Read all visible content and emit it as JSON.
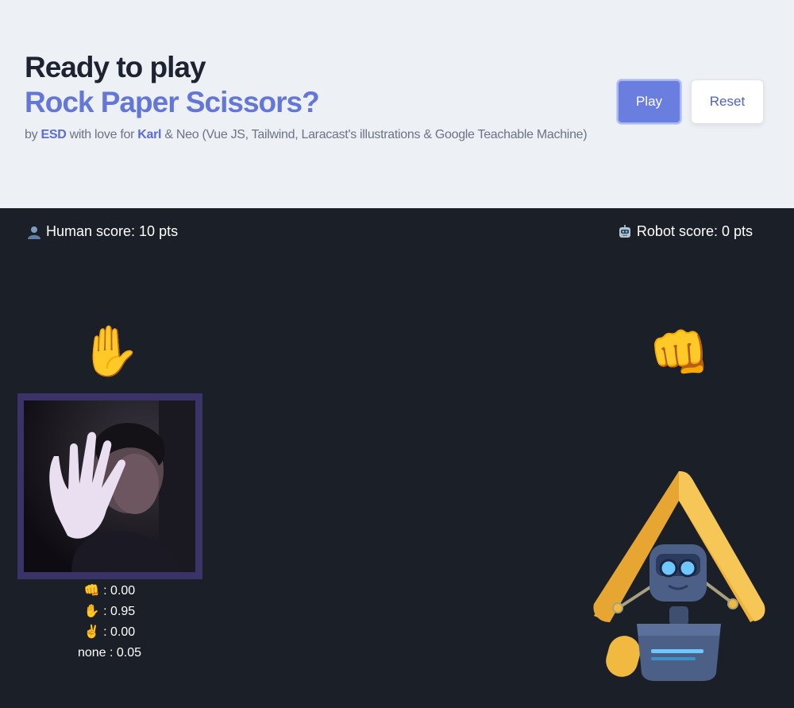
{
  "header": {
    "title_line1": "Ready to play",
    "title_line2": "Rock Paper Scissors?",
    "byline": {
      "prefix": "by",
      "author": "ESD",
      "middle": "with love for",
      "dedicatee": "Karl",
      "suffix": "& Neo (Vue JS, Tailwind, Laracast's illustrations & Google Teachable Machine)"
    },
    "play_label": "Play",
    "reset_label": "Reset"
  },
  "scores": {
    "human_label": "Human score: 10 pts",
    "robot_label": "Robot score: 0 pts"
  },
  "human": {
    "gesture_emoji": "✋"
  },
  "robot": {
    "gesture_emoji": "👊"
  },
  "predictions": [
    {
      "label": "👊 : 0.00"
    },
    {
      "label": "✋ : 0.95"
    },
    {
      "label": "✌️ : 0.00"
    },
    {
      "label": "none : 0.05"
    }
  ],
  "colors": {
    "accent": "#6477d6",
    "dark_bg": "#1b1f27",
    "header_bg": "#edf0f5",
    "robot_yellow": "#f2b940"
  },
  "icons": {
    "human": "bust-in-silhouette-icon",
    "robot": "robot-face-icon"
  }
}
